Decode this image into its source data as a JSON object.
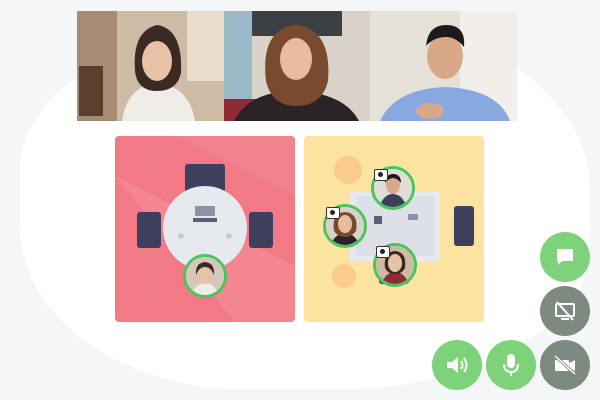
{
  "participants": [
    {
      "role": "participant-1"
    },
    {
      "role": "participant-2"
    },
    {
      "role": "participant-3"
    }
  ],
  "rooms": [
    {
      "id": "table-room-a",
      "color": "#f17a86",
      "seated_count": 1
    },
    {
      "id": "table-room-b",
      "color": "#fde3a0",
      "seated_count": 3
    }
  ],
  "controls": {
    "chat": {
      "icon": "chat-icon",
      "state": "on",
      "color": "#7ed27a"
    },
    "screen_share": {
      "icon": "screen-share-off-icon",
      "state": "off",
      "color": "#7e8a80"
    },
    "speaker": {
      "icon": "speaker-icon",
      "state": "on",
      "color": "#7ed27a"
    },
    "microphone": {
      "icon": "microphone-icon",
      "state": "on",
      "color": "#7ed27a"
    },
    "camera": {
      "icon": "camera-off-icon",
      "state": "off",
      "color": "#7e8a80"
    }
  },
  "colors": {
    "accent_green": "#48c55b",
    "button_green": "#7ed27a",
    "button_gray": "#7e8a80"
  }
}
